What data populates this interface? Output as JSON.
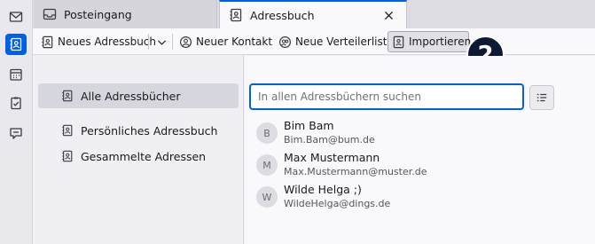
{
  "tabs": [
    {
      "label": "Posteingang",
      "icon": "inbox-icon",
      "active": false
    },
    {
      "label": "Adressbuch",
      "icon": "address-book-icon",
      "active": true
    }
  ],
  "toolbar": {
    "new_addressbook": "Neues Adressbuch",
    "new_contact": "Neuer Kontakt",
    "new_list": "Neue Verteilerliste",
    "import": "Importieren"
  },
  "badge": {
    "number": "2"
  },
  "sidebar": {
    "items": [
      {
        "label": "Alle Adressbücher",
        "selected": true
      },
      {
        "label": "Persönliches Adressbuch",
        "selected": false
      },
      {
        "label": "Gesammelte Adressen",
        "selected": false
      }
    ]
  },
  "search": {
    "placeholder": "In allen Adressbüchern suchen",
    "value": ""
  },
  "contacts": [
    {
      "initial": "B",
      "name": "Bim Bam",
      "email": "Bim.Bam@bum.de"
    },
    {
      "initial": "M",
      "name": "Max Mustermann",
      "email": "Max.Mustermann@muster.de"
    },
    {
      "initial": "W",
      "name": "Wilde Helga ;)",
      "email": "WildeHelga@dings.de"
    }
  ],
  "colors": {
    "accent": "#0060df",
    "badge": "#0d1a36"
  }
}
